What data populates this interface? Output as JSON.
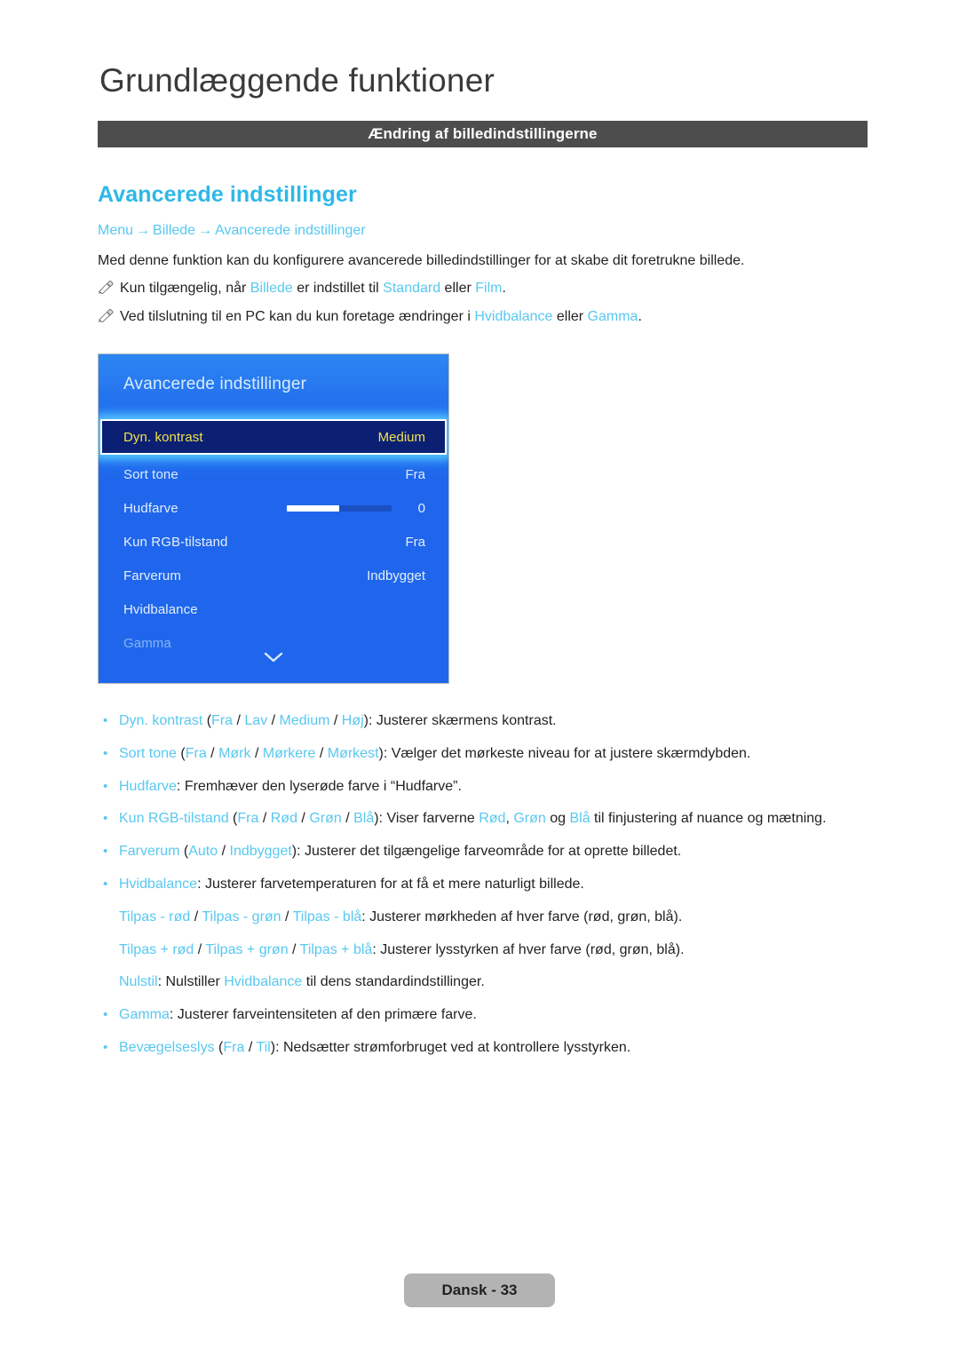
{
  "chapter": {
    "title": "Grundlæggende funktioner"
  },
  "section_band": {
    "title": "Ændring af billedindstillingerne"
  },
  "feature": {
    "heading": "Avancerede indstillinger"
  },
  "breadcrumb": {
    "item1": "Menu",
    "arrow1": "→",
    "item2": "Billede",
    "arrow2": "→",
    "item3": "Avancerede indstillinger"
  },
  "intro": "Med denne funktion kan du konfigurere avancerede billedindstillinger for at skabe dit foretrukne billede.",
  "notes": [
    {
      "icon": "note-pencil-icon",
      "p1": "Kun tilgængelig, når ",
      "h1": "Billede",
      "p2": " er indstillet til ",
      "h2": "Standard",
      "p3": " eller ",
      "h3": "Film",
      "p4": "."
    },
    {
      "icon": "note-pencil-icon",
      "p1": "Ved tilslutning til en PC kan du kun foretage ændringer i ",
      "h1": "Hvidbalance",
      "p2": " eller ",
      "h2": "Gamma",
      "p3": ".",
      "h3": "",
      "p4": ""
    }
  ],
  "tv_menu": {
    "title": "Avancerede indstillinger",
    "chevron_icon": "chevron-down-icon",
    "rows": [
      {
        "label": "Dyn. kontrast",
        "value": "Medium",
        "type": "value",
        "state": "selected"
      },
      {
        "label": "Sort tone",
        "value": "Fra",
        "type": "value",
        "state": "normal"
      },
      {
        "label": "Hudfarve",
        "value": "0",
        "type": "slider",
        "slider_percent": 50,
        "state": "normal"
      },
      {
        "label": "Kun RGB-tilstand",
        "value": "Fra",
        "type": "value",
        "state": "normal"
      },
      {
        "label": "Farverum",
        "value": "Indbygget",
        "type": "value",
        "state": "normal"
      },
      {
        "label": "Hvidbalance",
        "value": "",
        "type": "value",
        "state": "normal"
      },
      {
        "label": "Gamma",
        "value": "",
        "type": "value",
        "state": "dim"
      }
    ]
  },
  "descriptions": {
    "b1": {
      "term": "Dyn. kontrast",
      "open": " (",
      "o1": "Fra",
      "s1": " / ",
      "o2": "Lav",
      "s2": " / ",
      "o3": "Medium",
      "s3": " / ",
      "o4": "Høj",
      "close": ")",
      "text": ": Justerer skærmens kontrast."
    },
    "b2": {
      "term": "Sort tone",
      "open": " (",
      "o1": "Fra",
      "s1": " / ",
      "o2": "Mørk",
      "s2": " / ",
      "o3": "Mørkere",
      "s3": " / ",
      "o4": "Mørkest",
      "close": ")",
      "text": ": Vælger det mørkeste niveau for at justere skærmdybden."
    },
    "b3": {
      "term": "Hudfarve",
      "text": ": Fremhæver den lyserøde farve i “Hudfarve”."
    },
    "b4": {
      "term": "Kun RGB-tilstand",
      "open": " (",
      "o1": "Fra",
      "s1": " / ",
      "o2": "Rød",
      "s2": " / ",
      "o3": "Grøn",
      "s3": " / ",
      "o4": "Blå",
      "close": ")",
      "t1": ": Viser farverne ",
      "c1": "Rød",
      "t2": ", ",
      "c2": "Grøn",
      "t3": " og ",
      "c3": "Blå",
      "t4": " til finjustering af nuance og mætning."
    },
    "b5": {
      "term": "Farverum",
      "open": " (",
      "o1": "Auto",
      "s1": " / ",
      "o2": "Indbygget",
      "close": ")",
      "text": ": Justerer det tilgængelige farveområde for at oprette billedet."
    },
    "b6": {
      "term": "Hvidbalance",
      "text": ": Justerer farvetemperaturen for at få et mere naturligt billede."
    },
    "sub1": {
      "o1": "Tilpas - rød",
      "s1": " / ",
      "o2": "Tilpas - grøn",
      "s2": " / ",
      "o3": "Tilpas - blå",
      "text": ": Justerer mørkheden af hver farve (rød, grøn, blå)."
    },
    "sub2": {
      "o1": "Tilpas + rød",
      "s1": " / ",
      "o2": "Tilpas + grøn",
      "s2": " / ",
      "o3": "Tilpas + blå",
      "text": ": Justerer lysstyrken af hver farve (rød, grøn, blå)."
    },
    "sub3": {
      "term": "Nulstil",
      "t1": ": Nulstiller ",
      "c1": "Hvidbalance",
      "t2": " til dens standardindstillinger."
    },
    "b7": {
      "term": "Gamma",
      "text": ": Justerer farveintensiteten af den primære farve."
    },
    "b8": {
      "term": "Bevægelseslys",
      "open": " (",
      "o1": "Fra",
      "s1": " / ",
      "o2": "Til",
      "close": ")",
      "text": ": Nedsætter strømforbruget ved at kontrollere lysstyrken."
    }
  },
  "footer": {
    "label": "Dansk - 33"
  },
  "colors": {
    "accent_cyan": "#58c8f0",
    "heading_cyan": "#2eb8e8",
    "band_grey": "#4d4d4d",
    "panel_blue": "#1f66ec",
    "selected_navy": "#0b1f73",
    "selected_yellow": "#f2e14a",
    "footer_grey": "#b3b3b3"
  }
}
